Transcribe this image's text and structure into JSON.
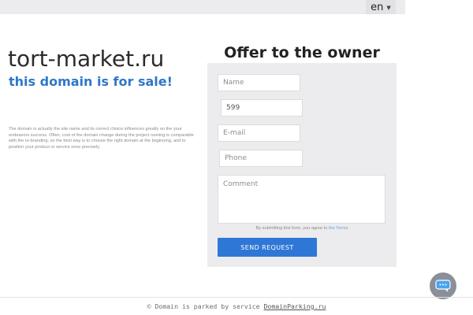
{
  "header": {
    "language": "en"
  },
  "main": {
    "domain": "tort-market.ru",
    "for_sale": "this domain is for sale!",
    "description": "The domain is actually the site name and its correct choice influences greatly on the your endeavors success. Often, cost of the domain change during the project running is comparable with the re-branding, so the best way is to choose the right domain at the beginning, and to position your product or service once precisely."
  },
  "offer": {
    "title": "Offer to the owner",
    "name_placeholder": "Name",
    "captcha_value": "599",
    "email_placeholder": "E-mail",
    "phone_placeholder": "Phone",
    "comment_placeholder": "Comment",
    "terms_text": "By submitting this form, you agree to",
    "terms_link": "the Terms",
    "send_label": "SEND REQUEST"
  },
  "footer": {
    "text": "© Domain is parked by service",
    "link": "DomainParking.ru"
  },
  "icons": {
    "language_chevron": "chevron-down-icon",
    "chat": "chat-bubble-icon"
  },
  "colors": {
    "accent": "#2f77d6",
    "for_sale_text": "#2f77c7",
    "panel_bg": "#ececee",
    "chat_button": "#8a8f98",
    "chat_icon": "#4aa3f0"
  }
}
